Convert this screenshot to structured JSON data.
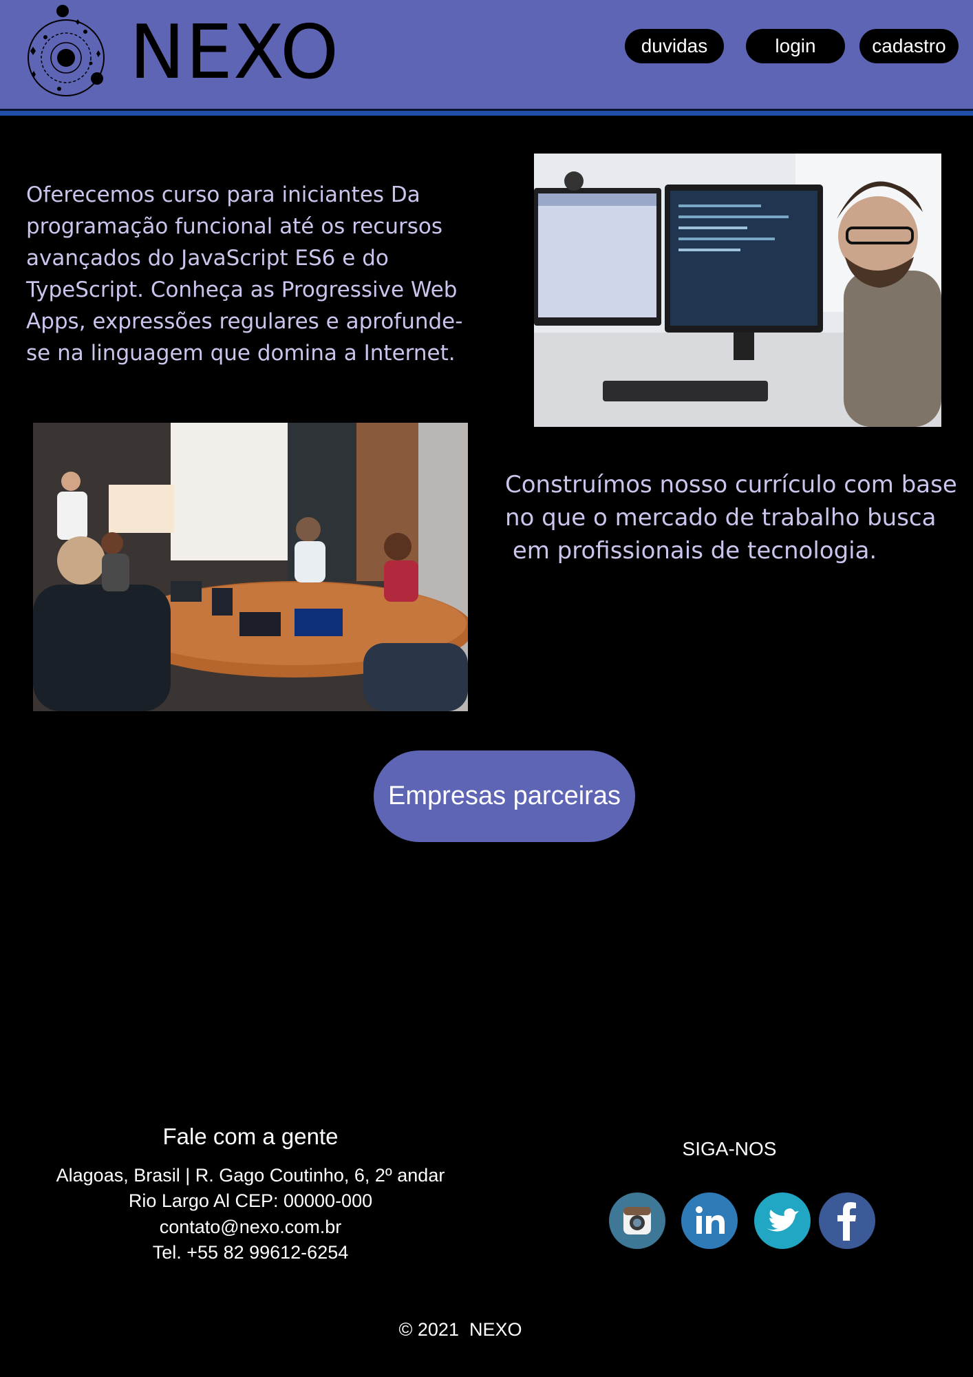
{
  "header": {
    "brand": "NEXO",
    "logo_icon": "galaxy-orbit-icon",
    "colors": {
      "bar": "#5f65b5",
      "rule": "#1f4fa8"
    },
    "nav": [
      {
        "label": "duvidas"
      },
      {
        "label": "login"
      },
      {
        "label": "cadastro"
      }
    ]
  },
  "main": {
    "intro_text": "Oferecemos curso para iniciantes Da programação funcional até os recursos avançados do JavaScript ES6 e do TypeScript. Conheça as Progressive Web Apps, expressões regulares e aprofunde-se na linguagem que domina a Internet.",
    "curriculum_text": "Construímos nosso currículo com base no que o mercado de trabalho busca\n em profissionais de tecnologia.",
    "partners_button": "Empresas parceiras",
    "accent_color": "#5f65b5"
  },
  "footer": {
    "contact_title": "Fale com a gente",
    "address_line1": "Alagoas, Brasil | R. Gago Coutinho, 6, 2º andar",
    "address_line2": "Rio Largo Al CEP: 00000-000",
    "email": "contato@nexo.com.br",
    "phone": "Tel. +55 82 99612-6254",
    "follow_title": "SIGA-NOS",
    "social": [
      {
        "icon": "instagram-icon",
        "color": "#3f7796"
      },
      {
        "icon": "linkedin-icon",
        "color": "#2f7bb8"
      },
      {
        "icon": "twitter-icon",
        "color": "#21a6c4"
      },
      {
        "icon": "facebook-icon",
        "color": "#3c5a98"
      }
    ],
    "copyright": "© 2021  NEXO"
  }
}
